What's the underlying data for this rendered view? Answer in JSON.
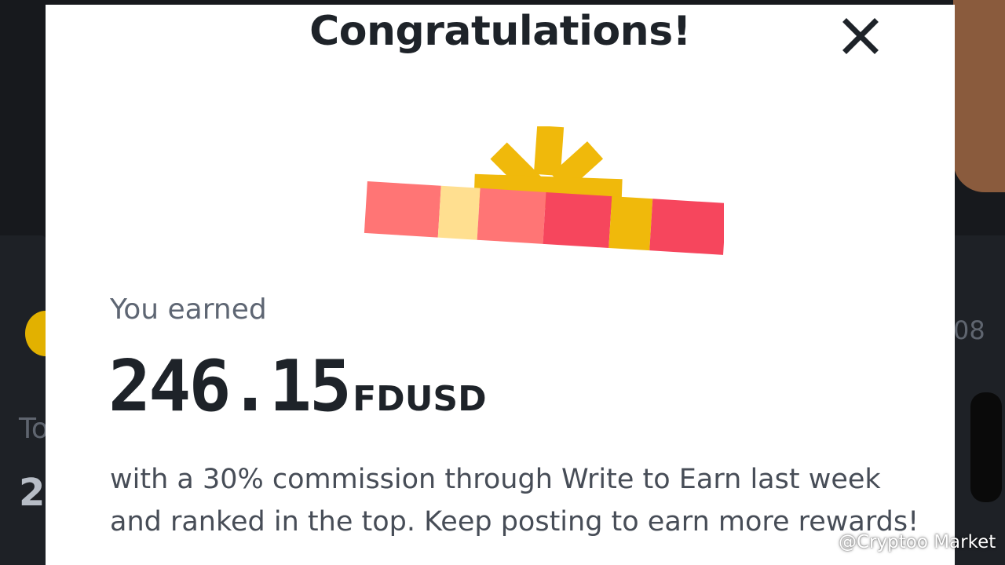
{
  "background": {
    "left_label": "To",
    "left_value": "2",
    "right_value": "08"
  },
  "modal": {
    "title": "Congratulations!",
    "close_icon": "close-icon",
    "illustration": "gift-box-icon",
    "earned_label": "You earned",
    "amount": "246.15",
    "currency": "FDUSD",
    "description": "with a 30% commission through Write to Earn last week and ranked in the top. Keep posting to earn more rewards!"
  },
  "watermark": {
    "handle": "@Cryptoo Market",
    "icon": "binance-logo-icon"
  },
  "colors": {
    "accent_yellow": "#f0b90b",
    "gift_red": "#f6465d",
    "text_primary": "#1e2329",
    "text_secondary": "#5e6673"
  }
}
